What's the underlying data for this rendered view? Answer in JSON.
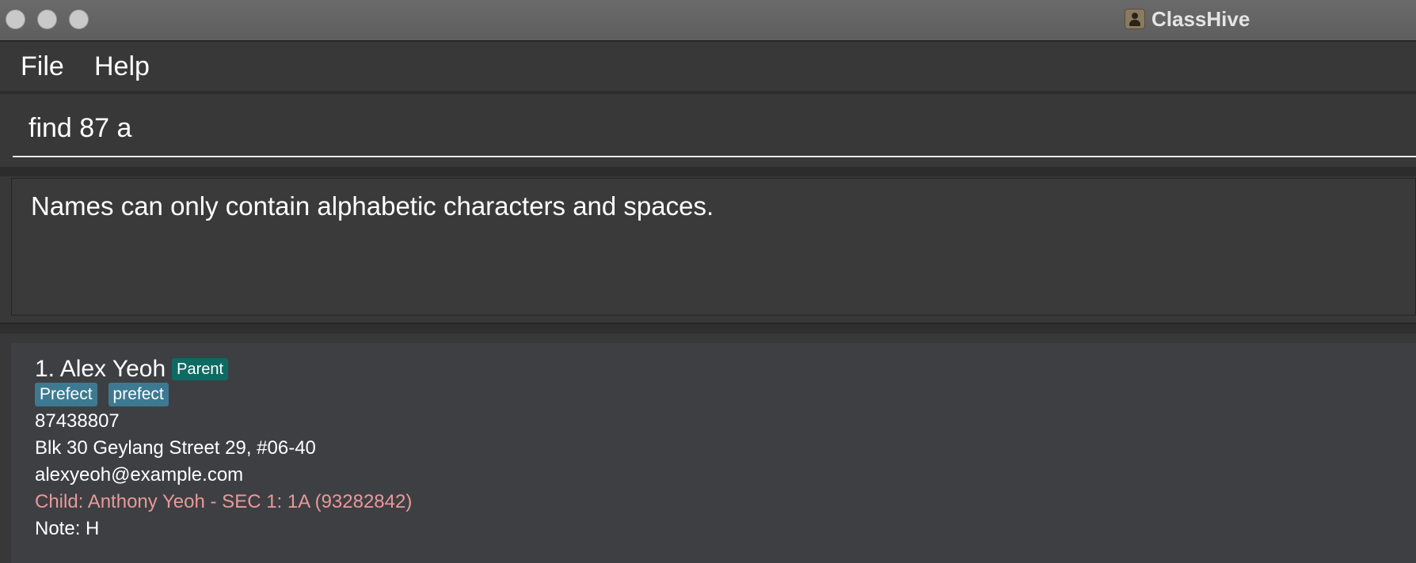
{
  "window": {
    "title": "ClassHive",
    "icon": "contact-card-icon"
  },
  "menu": {
    "items": [
      "File",
      "Help"
    ]
  },
  "command": {
    "value": "find 87 a"
  },
  "result": {
    "message": "Names can only contain alphabetic characters and spaces."
  },
  "persons": [
    {
      "index_name": "1. Alex Yeoh",
      "role": "Parent",
      "tags": [
        "Prefect",
        "prefect"
      ],
      "phone": "87438807",
      "address": "Blk 30 Geylang Street 29, #06-40",
      "email": "alexyeoh@example.com",
      "child": "Child: Anthony Yeoh - SEC 1: 1A (93282842)",
      "note": "Note: H"
    }
  ],
  "colors": {
    "role_badge": "#0d6b64",
    "tag": "#3d7a91",
    "child_text": "#e89999",
    "card_bg": "#3e3f43"
  }
}
